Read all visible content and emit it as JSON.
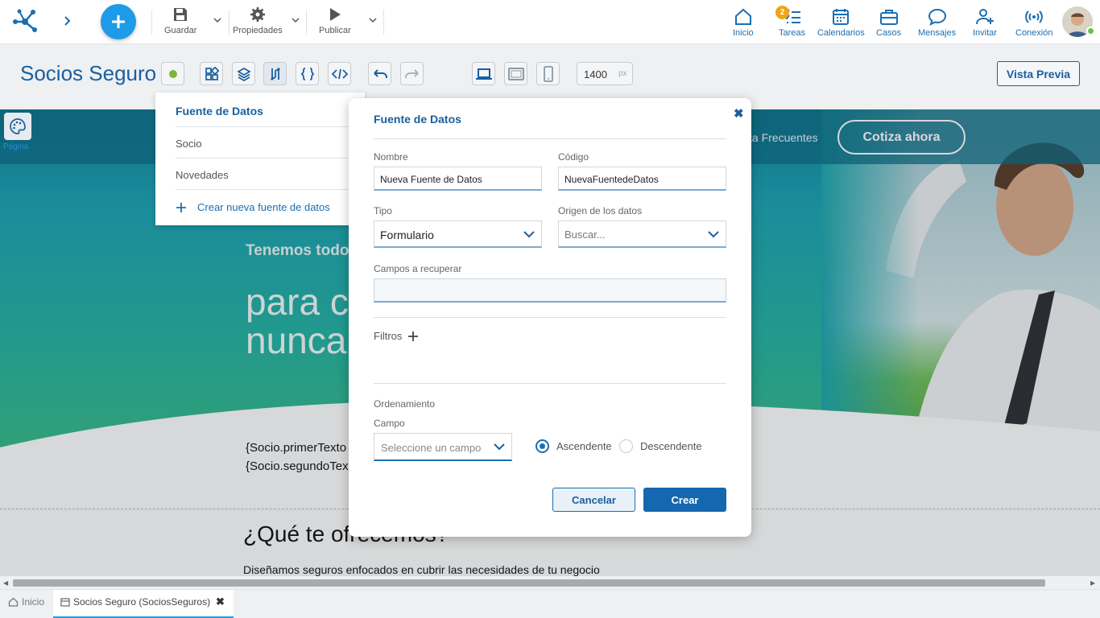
{
  "topbar": {
    "save": "Guardar",
    "properties": "Propiedades",
    "publish": "Publicar",
    "nav": [
      {
        "id": "home",
        "label": "Inicio"
      },
      {
        "id": "tasks",
        "label": "Tareas",
        "badge": "2"
      },
      {
        "id": "calendars",
        "label": "Calendarios"
      },
      {
        "id": "cases",
        "label": "Casos"
      },
      {
        "id": "messages",
        "label": "Mensajes"
      },
      {
        "id": "invite",
        "label": "Invitar"
      },
      {
        "id": "connection",
        "label": "Conexión"
      }
    ]
  },
  "editor": {
    "title": "Socios Seguro",
    "width_value": "1400",
    "width_unit": "px",
    "preview_label": "Vista Previa",
    "page_label": "Página"
  },
  "site": {
    "nav_faq": "ta Frecuentes",
    "cta": "Cotiza ahora",
    "tagline": "Tenemos todo",
    "hero_line1": "para c",
    "hero_line2": "nunca",
    "socio1": "{Socio.primerTexto",
    "socio2": "{Socio.segundoTex",
    "offer_title": "¿Qué te ofrecemos?",
    "offer_sub": "Diseñamos seguros enfocados en cubrir las necesidades de tu negocio"
  },
  "datasource_menu": {
    "title": "Fuente de Datos",
    "items": [
      "Socio",
      "Novedades"
    ],
    "create": "Crear nueva fuente de datos"
  },
  "modal": {
    "title": "Fuente de Datos",
    "name_label": "Nombre",
    "name_value": "Nueva Fuente de Datos",
    "code_label": "Código",
    "code_value": "NuevaFuentedeDatos",
    "type_label": "Tipo",
    "type_value": "Formulario",
    "origin_label": "Origen de los datos",
    "origin_placeholder": "Buscar...",
    "fields_label": "Campos a recuperar",
    "filters_label": "Filtros",
    "ordering_label": "Ordenamiento",
    "field_label": "Campo",
    "field_placeholder": "Seleccione un campo",
    "asc_label": "Ascendente",
    "desc_label": "Descendente",
    "order_selected": "Ascendente",
    "cancel": "Cancelar",
    "create": "Crear"
  },
  "tabs": {
    "home": "Inicio",
    "doc": "Socios Seguro (SociosSeguros)"
  },
  "colors": {
    "primary": "#1a5fa0",
    "accent": "#1e9be6",
    "badge": "#f0a416"
  }
}
